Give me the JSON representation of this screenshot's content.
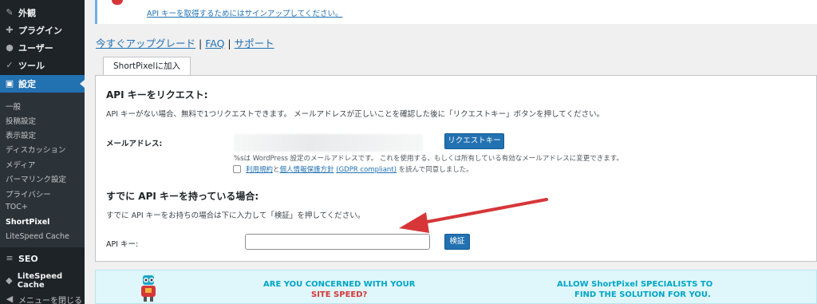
{
  "sidebar": {
    "items": [
      {
        "label": "外観",
        "icon": "brush-icon"
      },
      {
        "label": "プラグイン",
        "icon": "plugin-icon"
      },
      {
        "label": "ユーザー",
        "icon": "user-icon"
      },
      {
        "label": "ツール",
        "icon": "wrench-icon"
      },
      {
        "label": "設定",
        "icon": "settings-icon"
      }
    ],
    "submenu": [
      "一般",
      "投稿設定",
      "表示設定",
      "ディスカッション",
      "メディア",
      "パーマリンク設定",
      "プライバシー",
      "TOC+",
      "ShortPixel",
      "LiteSpeed Cache"
    ],
    "seo": {
      "label": "SEO",
      "icon": "seo-icon"
    },
    "litespeed": {
      "label": "LiteSpeed Cache",
      "icon": "litespeed-icon"
    },
    "collapse": {
      "label": "メニューを閉じる",
      "icon": "collapse-icon"
    }
  },
  "notice": {
    "link": "API キーを取得するためにはサインアップしてください。"
  },
  "links": {
    "upgrade": "今すぐアップグレード",
    "faq": "FAQ",
    "support": "サポート",
    "sep": "|"
  },
  "tab": {
    "label": "ShortPixelに加入"
  },
  "request": {
    "title": "API キーをリクエスト:",
    "desc": "API キーがない場合、無料で1つリクエストできます。 メールアドレスが正しいことを確認した後に「リクエストキー」ボタンを押してください。",
    "email_label": "メールアドレス:",
    "button": "リクエストキー",
    "hint": "%sは WordPress 設定のメールアドレスです。 これを使用する、もしくは所有している有効なメールアドレスに変更できます。",
    "agree_terms": "利用規約",
    "agree_and": "と",
    "agree_privacy": "個人情報保護方針",
    "agree_gdpr": "(GDPR compliant)",
    "agree_suffix": "を読んで同意しました。"
  },
  "existing": {
    "title": "すでに API キーを持っている場合:",
    "desc": "すでに API キーをお持ちの場合は下に入力して「検証」を押してください。",
    "api_label": "API キー:",
    "api_value": "",
    "button": "検証"
  },
  "banner": {
    "left_line1": "ARE YOU CONCERNED WITH YOUR",
    "left_line2": "SITE SPEED?",
    "right_line1": "ALLOW ShortPixel SPECIALISTS TO",
    "right_line2": "FIND THE SOLUTION FOR YOU."
  },
  "colors": {
    "accent": "#2271b1",
    "sidebar": "#1d2327",
    "arrow": "#d63638",
    "banner_text": "#00a5c4"
  }
}
